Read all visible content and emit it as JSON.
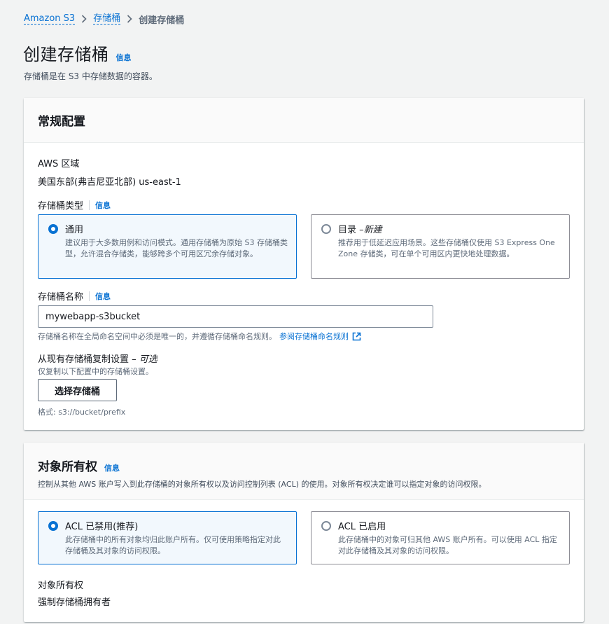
{
  "breadcrumb": {
    "items": [
      "Amazon S3",
      "存储桶"
    ],
    "current": "创建存储桶"
  },
  "page": {
    "title": "创建存储桶",
    "info": "信息",
    "description": "存储桶是在 S3 中存储数据的容器。"
  },
  "general": {
    "title": "常规配置",
    "region_label": "AWS 区域",
    "region_value": "美国东部(弗吉尼亚北部) us-east-1",
    "bucket_type_label": "存储桶类型",
    "bucket_type_info": "信息",
    "types": [
      {
        "label": "通用",
        "label_suffix": "",
        "desc": "建议用于大多数用例和访问模式。通用存储桶为原始 S3 存储桶类型，允许混合存储类，能够跨多个可用区冗余存储对象。",
        "selected": true
      },
      {
        "label": "目录 – ",
        "label_suffix": "新建",
        "desc": "推荐用于低延迟应用场景。这些存储桶仅使用 S3 Express One Zone 存储类，可在单个可用区内更快地处理数据。",
        "selected": false
      }
    ],
    "bucket_name_label": "存储桶名称",
    "bucket_name_info": "信息",
    "bucket_name_value": "mywebapp-s3bucket",
    "bucket_name_hint": "存储桶名称在全局命名空间中必须是唯一的，并遵循存储桶命名规则。",
    "bucket_name_rules_link": "参阅存储桶命名规则",
    "copy_label": "从现有存储桶复制设置 – ",
    "copy_label_optional": "可选",
    "copy_hint": "仅复制以下配置中的存储桶设置。",
    "choose_bucket_button": "选择存储桶",
    "format_hint": "格式: s3://bucket/prefix"
  },
  "ownership": {
    "title": "对象所有权",
    "info": "信息",
    "description": "控制从其他 AWS 账户写入到此存储桶的对象所有权以及访问控制列表 (ACL) 的使用。对象所有权决定谁可以指定对象的访问权限。",
    "options": [
      {
        "label": "ACL 已禁用(推荐)",
        "desc": "此存储桶中的所有对象均归此账户所有。仅可使用策略指定对此存储桶及其对象的访问权限。",
        "selected": true
      },
      {
        "label": "ACL 已启用",
        "desc": "此存储桶中的对象可归其他 AWS 账户所有。可以使用 ACL 指定对此存储桶及其对象的访问权限。",
        "selected": false
      }
    ],
    "ownership_label": "对象所有权",
    "ownership_value": "强制存储桶拥有者"
  },
  "colors": {
    "link": "#0972d3",
    "selected_bg": "#f2f8fd",
    "page_bg": "#f2f3f3"
  }
}
